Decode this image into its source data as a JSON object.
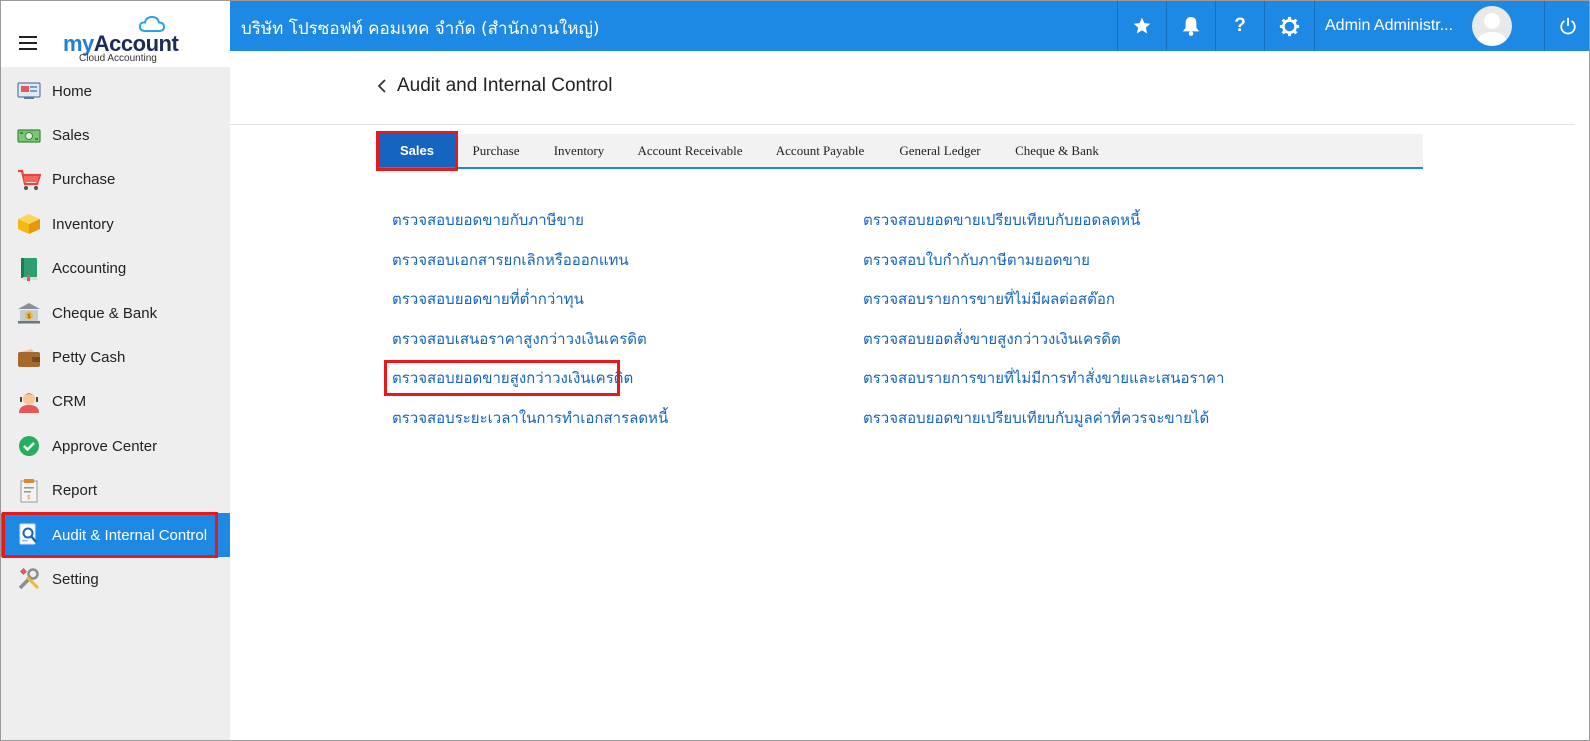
{
  "app": {
    "logo_brand_prefix": "my",
    "logo_brand_suffix": "Account",
    "logo_sub": "Cloud Accounting"
  },
  "topbar": {
    "company": "บริษัท โปรซอฟท์ คอมเทค จำกัด (สำนักงานใหญ่)",
    "user_name": "Admin Administr...",
    "icons": [
      "star-icon",
      "bell-icon",
      "help-icon",
      "gear-icon",
      "power-icon"
    ]
  },
  "sidebar": {
    "items": [
      {
        "label": "Home",
        "icon": "home-icon"
      },
      {
        "label": "Sales",
        "icon": "sales-icon"
      },
      {
        "label": "Purchase",
        "icon": "cart-icon"
      },
      {
        "label": "Inventory",
        "icon": "box-icon"
      },
      {
        "label": "Accounting",
        "icon": "book-icon"
      },
      {
        "label": "Cheque & Bank",
        "icon": "bank-icon"
      },
      {
        "label": "Petty Cash",
        "icon": "wallet-icon"
      },
      {
        "label": "CRM",
        "icon": "crm-icon"
      },
      {
        "label": "Approve Center",
        "icon": "check-icon"
      },
      {
        "label": "Report",
        "icon": "report-icon"
      },
      {
        "label": "Audit & Internal Control",
        "icon": "audit-icon",
        "active": true
      },
      {
        "label": "Setting",
        "icon": "tools-icon"
      }
    ]
  },
  "page": {
    "title": "Audit and Internal Control"
  },
  "tabs": [
    {
      "label": "Sales",
      "active": true
    },
    {
      "label": "Purchase"
    },
    {
      "label": "Inventory"
    },
    {
      "label": "Account Receivable"
    },
    {
      "label": "Account Payable"
    },
    {
      "label": "General Ledger"
    },
    {
      "label": "Cheque & Bank"
    }
  ],
  "links_left": [
    "ตรวจสอบยอดขายกับภาษีขาย",
    "ตรวจสอบเอกสารยกเลิกหรือออกแทน",
    "ตรวจสอบยอดขายที่ต่ำกว่าทุน",
    "ตรวจสอบเสนอราคาสูงกว่าวงเงินเครดิต",
    "ตรวจสอบยอดขายสูงกว่าวงเงินเครดิต",
    "ตรวจสอบระยะเวลาในการทำเอกสารลดหนี้"
  ],
  "links_right": [
    "ตรวจสอบยอดขายเปรียบเทียบกับยอดลดหนี้",
    "ตรวจสอบใบกำกับภาษีตามยอดขาย",
    "ตรวจสอบรายการขายที่ไม่มีผลต่อสต๊อก",
    "ตรวจสอบยอดสั่งขายสูงกว่าวงเงินเครดิต",
    "ตรวจสอบรายการขายที่ไม่มีการทำสั่งขายและเสนอราคา",
    "ตรวจสอบยอดขายเปรียบเทียบกับมูลค่าที่ควรจะขายได้"
  ],
  "colors": {
    "primary": "#1e88e5",
    "tab_active": "#1565c0",
    "highlight": "#e8191c",
    "link": "#1565c0"
  }
}
